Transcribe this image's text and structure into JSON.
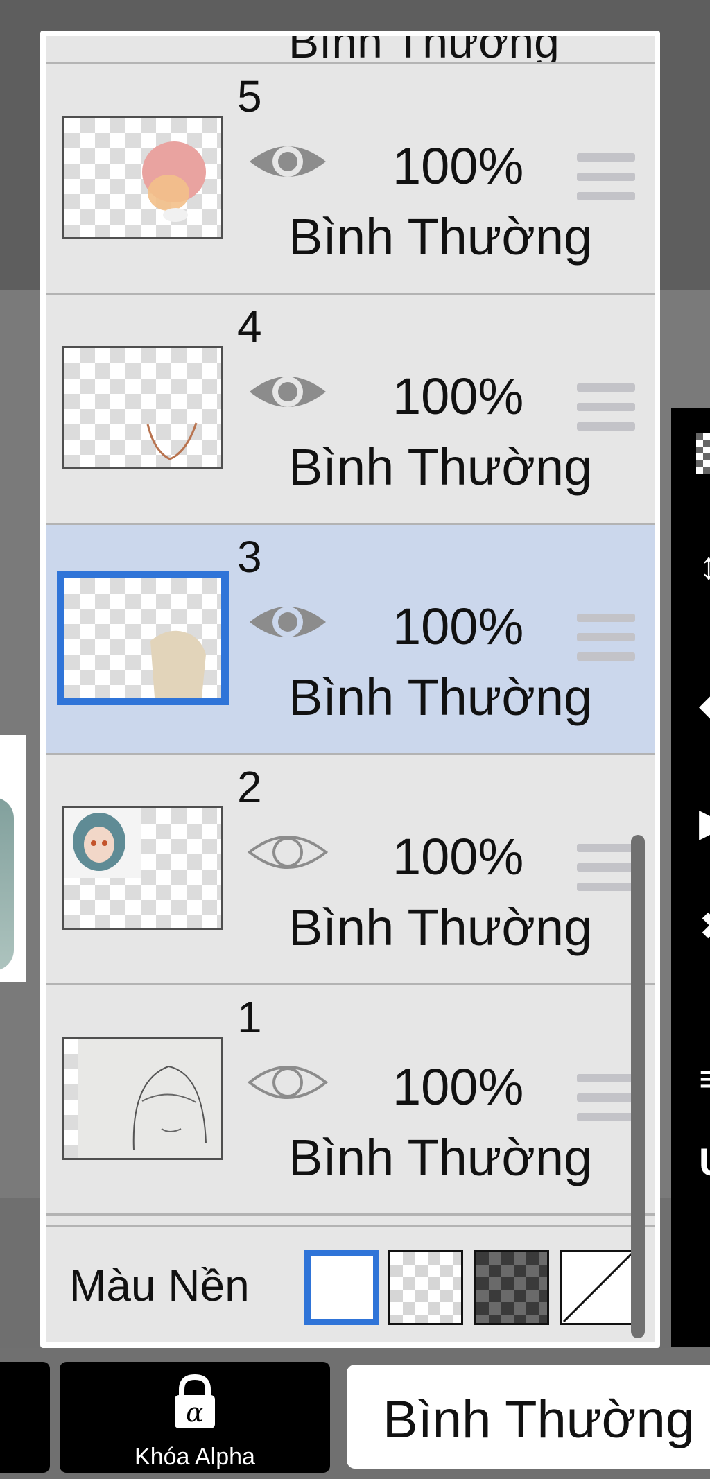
{
  "panel": {
    "partial_top_label": "Bình Thường",
    "layers": [
      {
        "number": "5",
        "opacity": "100%",
        "blend_mode": "Bình Thường",
        "visible": true,
        "selected": false
      },
      {
        "number": "4",
        "opacity": "100%",
        "blend_mode": "Bình Thường",
        "visible": true,
        "selected": false
      },
      {
        "number": "3",
        "opacity": "100%",
        "blend_mode": "Bình Thường",
        "visible": true,
        "selected": true
      },
      {
        "number": "2",
        "opacity": "100%",
        "blend_mode": "Bình Thường",
        "visible": false,
        "selected": false
      },
      {
        "number": "1",
        "opacity": "100%",
        "blend_mode": "Bình Thường",
        "visible": false,
        "selected": false
      }
    ],
    "background": {
      "label": "Màu Nền",
      "options": [
        "white",
        "light-checker",
        "dark-checker",
        "none"
      ],
      "selected": "white"
    }
  },
  "bottom_bar": {
    "alpha_lock_label": "Khóa Alpha",
    "alpha_symbol": "α",
    "blend_mode_label": "Bình Thường"
  },
  "colors": {
    "accent": "#2f74d8",
    "selected_row": "#cbd7ec",
    "panel_bg": "#e6e6e6"
  }
}
